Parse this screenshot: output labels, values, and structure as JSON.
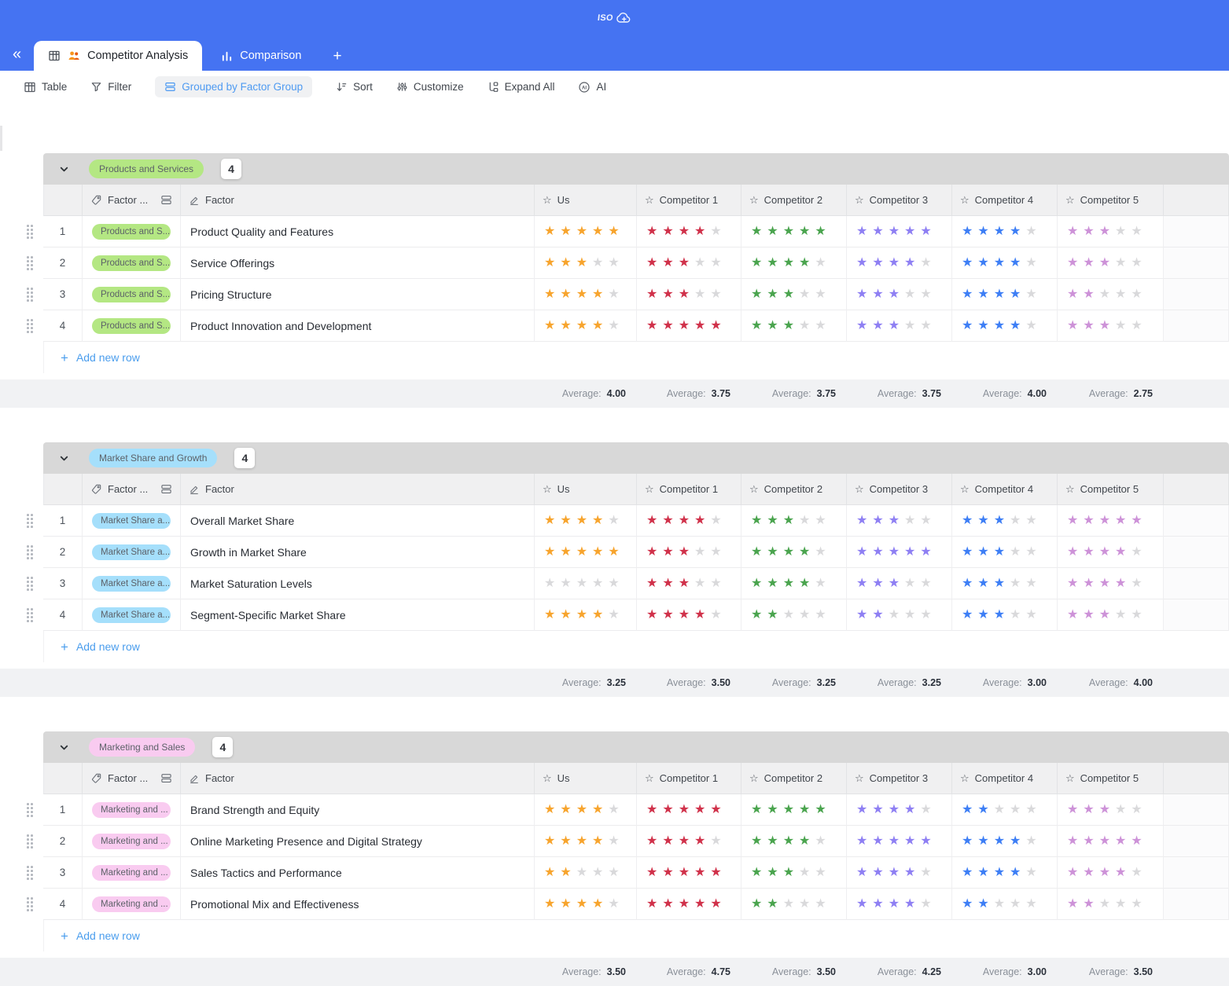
{
  "topbar": {
    "cloud_label": "ISO"
  },
  "tabs": [
    {
      "label": "Competitor Analysis",
      "active": true
    },
    {
      "label": "Comparison",
      "active": false
    }
  ],
  "add_tab_label": "+",
  "toolbar": {
    "table": "Table",
    "filter": "Filter",
    "grouped": "Grouped by Factor Group",
    "sort": "Sort",
    "customize": "Customize",
    "expand_all": "Expand All",
    "ai": "AI"
  },
  "columns": {
    "factor_group": "Factor ...",
    "factor": "Factor",
    "raters": [
      "Us",
      "Competitor 1",
      "Competitor 2",
      "Competitor 3",
      "Competitor 4",
      "Competitor 5"
    ]
  },
  "labels": {
    "add_row": "Add new row",
    "average": "Average:",
    "plus": "+",
    "collapse": "«"
  },
  "colors": {
    "star_palette": [
      "#f7a42d",
      "#d0314a",
      "#4aa44e",
      "#8e7ff3",
      "#3d7ef5",
      "#cd92d8"
    ],
    "star_empty": "#d9d9db",
    "pill_text": "#5c6168",
    "topbar_blue": "#4573f2",
    "accent_blue": "#4e9af2"
  },
  "groups": [
    {
      "name": "Products and Services",
      "tag": "Products and S...",
      "count": "4",
      "pill_bg": "#b4e783",
      "rows": [
        {
          "num": "1",
          "factor": "Product Quality and Features",
          "ratings": [
            5,
            4,
            5,
            5,
            4,
            3
          ]
        },
        {
          "num": "2",
          "factor": "Service Offerings",
          "ratings": [
            3,
            3,
            4,
            4,
            4,
            3
          ]
        },
        {
          "num": "3",
          "factor": "Pricing Structure",
          "ratings": [
            4,
            3,
            3,
            3,
            4,
            2
          ]
        },
        {
          "num": "4",
          "factor": "Product Innovation and Development",
          "ratings": [
            4,
            5,
            3,
            3,
            4,
            3
          ]
        }
      ],
      "averages": [
        "4.00",
        "3.75",
        "3.75",
        "3.75",
        "4.00",
        "2.75"
      ]
    },
    {
      "name": "Market Share and Growth",
      "tag": "Market Share a...",
      "count": "4",
      "pill_bg": "#a5dffb",
      "rows": [
        {
          "num": "1",
          "factor": "Overall Market Share",
          "ratings": [
            4,
            4,
            3,
            3,
            3,
            5
          ]
        },
        {
          "num": "2",
          "factor": "Growth in Market Share",
          "ratings": [
            5,
            3,
            4,
            5,
            3,
            4
          ]
        },
        {
          "num": "3",
          "factor": "Market Saturation Levels",
          "ratings": [
            0,
            3,
            4,
            3,
            3,
            4
          ]
        },
        {
          "num": "4",
          "factor": "Segment-Specific Market Share",
          "ratings": [
            4,
            4,
            2,
            2,
            3,
            3
          ]
        }
      ],
      "averages": [
        "3.25",
        "3.50",
        "3.25",
        "3.25",
        "3.00",
        "4.00"
      ]
    },
    {
      "name": "Marketing and Sales",
      "tag": "Marketing and ...",
      "count": "4",
      "pill_bg": "#f9cbf0",
      "rows": [
        {
          "num": "1",
          "factor": "Brand Strength and Equity",
          "ratings": [
            4,
            5,
            5,
            4,
            2,
            3
          ]
        },
        {
          "num": "2",
          "factor": "Online Marketing Presence and Digital Strategy",
          "ratings": [
            4,
            4,
            4,
            5,
            4,
            5
          ]
        },
        {
          "num": "3",
          "factor": "Sales Tactics and Performance",
          "ratings": [
            2,
            5,
            3,
            4,
            4,
            4
          ]
        },
        {
          "num": "4",
          "factor": "Promotional Mix and Effectiveness",
          "ratings": [
            4,
            5,
            2,
            4,
            2,
            2
          ]
        }
      ],
      "averages": [
        "3.50",
        "4.75",
        "3.50",
        "4.25",
        "3.00",
        "3.50"
      ]
    }
  ]
}
